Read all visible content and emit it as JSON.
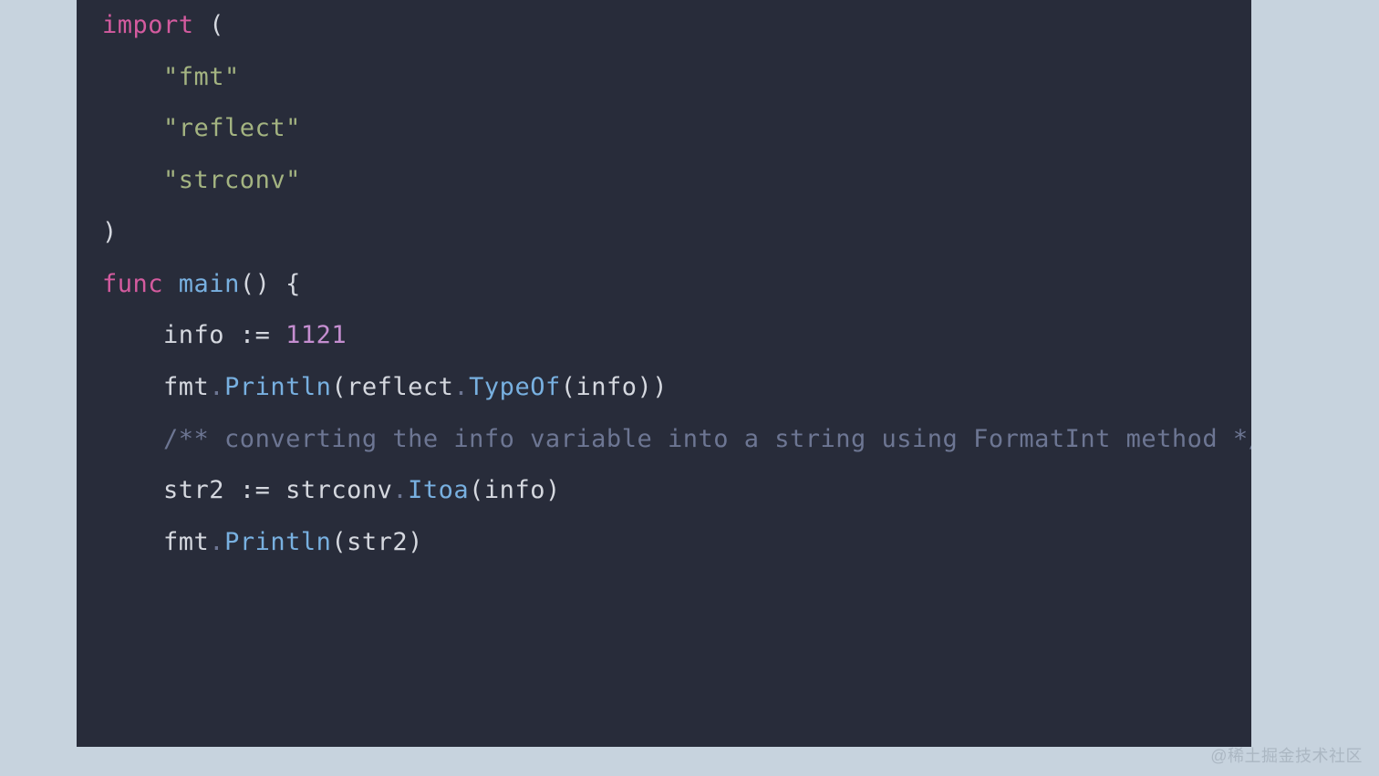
{
  "code": {
    "lines": [
      {
        "segments": [
          {
            "t": ""
          }
        ]
      },
      {
        "segments": [
          {
            "t": "import",
            "c": "tk-kw"
          },
          {
            "t": " (",
            "c": "tk-punc"
          }
        ]
      },
      {
        "segments": [
          {
            "t": "    "
          },
          {
            "t": "\"fmt\"",
            "c": "tk-str"
          }
        ]
      },
      {
        "segments": [
          {
            "t": "    "
          },
          {
            "t": "\"reflect\"",
            "c": "tk-str"
          }
        ]
      },
      {
        "segments": [
          {
            "t": "    "
          },
          {
            "t": "\"strconv\"",
            "c": "tk-str"
          }
        ]
      },
      {
        "segments": [
          {
            "t": ")",
            "c": "tk-punc"
          }
        ]
      },
      {
        "segments": [
          {
            "t": ""
          }
        ]
      },
      {
        "segments": [
          {
            "t": "func",
            "c": "tk-kw"
          },
          {
            "t": " "
          },
          {
            "t": "main",
            "c": "tk-fn"
          },
          {
            "t": "()",
            "c": "tk-punc"
          },
          {
            "t": " "
          },
          {
            "t": "{",
            "c": "tk-punc"
          }
        ]
      },
      {
        "segments": [
          {
            "t": ""
          }
        ]
      },
      {
        "segments": [
          {
            "t": "    info "
          },
          {
            "t": ":=",
            "c": "tk-punc"
          },
          {
            "t": " "
          },
          {
            "t": "1121",
            "c": "tk-num"
          }
        ]
      },
      {
        "segments": [
          {
            "t": "    fmt"
          },
          {
            "t": ".",
            "c": "tk-dot"
          },
          {
            "t": "Println",
            "c": "tk-fn"
          },
          {
            "t": "(reflect",
            "c": "tk-punc"
          },
          {
            "t": ".",
            "c": "tk-dot"
          },
          {
            "t": "TypeOf",
            "c": "tk-fn"
          },
          {
            "t": "(info))",
            "c": "tk-punc"
          }
        ]
      },
      {
        "segments": [
          {
            "t": "    "
          },
          {
            "t": "/** converting the info variable into a string using FormatInt method */",
            "c": "tk-cmt"
          }
        ]
      },
      {
        "segments": [
          {
            "t": "    str2 "
          },
          {
            "t": ":=",
            "c": "tk-punc"
          },
          {
            "t": " strconv"
          },
          {
            "t": ".",
            "c": "tk-dot"
          },
          {
            "t": "Itoa",
            "c": "tk-fn"
          },
          {
            "t": "(info)",
            "c": "tk-punc"
          }
        ]
      },
      {
        "segments": [
          {
            "t": "    fmt"
          },
          {
            "t": ".",
            "c": "tk-dot"
          },
          {
            "t": "Println",
            "c": "tk-fn"
          },
          {
            "t": "(str2)",
            "c": "tk-punc"
          }
        ]
      }
    ]
  },
  "watermark": "@稀土掘金技术社区"
}
